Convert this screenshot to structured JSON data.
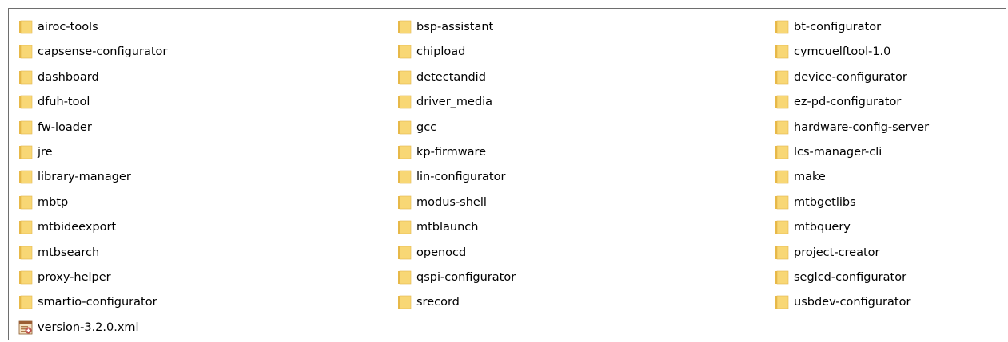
{
  "items": [
    {
      "name": "airoc-tools",
      "type": "folder"
    },
    {
      "name": "bsp-assistant",
      "type": "folder"
    },
    {
      "name": "bt-configurator",
      "type": "folder"
    },
    {
      "name": "capsense-configurator",
      "type": "folder"
    },
    {
      "name": "chipload",
      "type": "folder"
    },
    {
      "name": "cymcuelftool-1.0",
      "type": "folder"
    },
    {
      "name": "dashboard",
      "type": "folder"
    },
    {
      "name": "detectandid",
      "type": "folder"
    },
    {
      "name": "device-configurator",
      "type": "folder"
    },
    {
      "name": "dfuh-tool",
      "type": "folder"
    },
    {
      "name": "driver_media",
      "type": "folder"
    },
    {
      "name": "ez-pd-configurator",
      "type": "folder"
    },
    {
      "name": "fw-loader",
      "type": "folder"
    },
    {
      "name": "gcc",
      "type": "folder"
    },
    {
      "name": "hardware-config-server",
      "type": "folder"
    },
    {
      "name": "jre",
      "type": "folder"
    },
    {
      "name": "kp-firmware",
      "type": "folder"
    },
    {
      "name": "lcs-manager-cli",
      "type": "folder"
    },
    {
      "name": "library-manager",
      "type": "folder"
    },
    {
      "name": "lin-configurator",
      "type": "folder"
    },
    {
      "name": "make",
      "type": "folder"
    },
    {
      "name": "mbtp",
      "type": "folder"
    },
    {
      "name": "modus-shell",
      "type": "folder"
    },
    {
      "name": "mtbgetlibs",
      "type": "folder"
    },
    {
      "name": "mtbideexport",
      "type": "folder"
    },
    {
      "name": "mtblaunch",
      "type": "folder"
    },
    {
      "name": "mtbquery",
      "type": "folder"
    },
    {
      "name": "mtbsearch",
      "type": "folder"
    },
    {
      "name": "openocd",
      "type": "folder"
    },
    {
      "name": "project-creator",
      "type": "folder"
    },
    {
      "name": "proxy-helper",
      "type": "folder"
    },
    {
      "name": "qspi-configurator",
      "type": "folder"
    },
    {
      "name": "seglcd-configurator",
      "type": "folder"
    },
    {
      "name": "smartio-configurator",
      "type": "folder"
    },
    {
      "name": "srecord",
      "type": "folder"
    },
    {
      "name": "usbdev-configurator",
      "type": "folder"
    },
    {
      "name": "version-3.2.0.xml",
      "type": "xml-file"
    }
  ],
  "icons": {
    "folder": "folder-icon",
    "xml-file": "xml-file-icon"
  },
  "colors": {
    "folder_fill": "#f8d775",
    "folder_back": "#e8b948",
    "frame_border": "#6e6e6e",
    "xml_icon_base": "#c0504d"
  }
}
